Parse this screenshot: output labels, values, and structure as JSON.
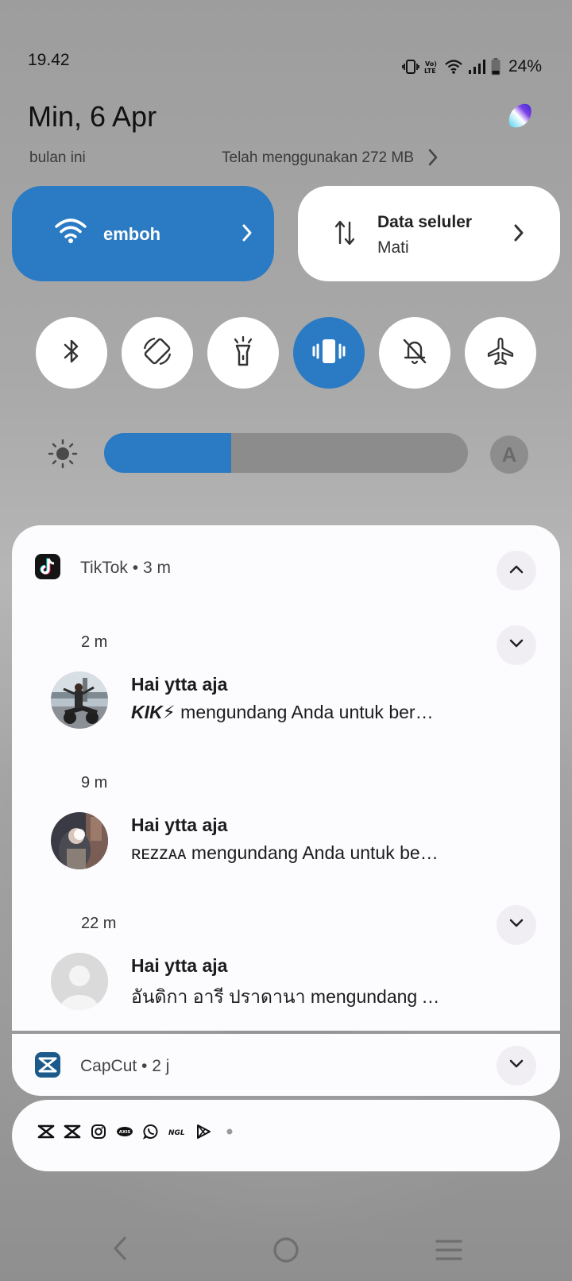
{
  "status_bar": {
    "time": "19.42",
    "battery": "24%",
    "icons": [
      "vibrate-icon",
      "volte-icon",
      "wifi-icon",
      "signal-icon",
      "battery-icon"
    ]
  },
  "header": {
    "date": "Min, 6 Apr",
    "usage_period": "bulan ini",
    "usage_text": "Telah menggunakan 272 MB"
  },
  "tiles": {
    "wifi": {
      "label": "emboh",
      "icon": "wifi-icon"
    },
    "data": {
      "title": "Data seluler",
      "status": "Mati",
      "icon": "data-arrows-icon"
    }
  },
  "toggles": [
    {
      "name": "bluetooth",
      "icon": "bluetooth-icon",
      "active": false
    },
    {
      "name": "auto-rotate",
      "icon": "rotate-icon",
      "active": false
    },
    {
      "name": "flashlight",
      "icon": "flashlight-icon",
      "active": false
    },
    {
      "name": "vibrate",
      "icon": "vibrate-icon",
      "active": true
    },
    {
      "name": "do-not-disturb",
      "icon": "bell-off-icon",
      "active": false
    },
    {
      "name": "airplane-mode",
      "icon": "airplane-icon",
      "active": false
    }
  ],
  "brightness": {
    "level": 0.35,
    "auto_label": "A"
  },
  "notifications": {
    "tiktok": {
      "app": "TikTok",
      "age": "3 m",
      "items": [
        {
          "time": "2 m",
          "title": "Hai ytta aja",
          "sender": "KIK⚡",
          "text": " mengundang Anda untuk bergabung"
        },
        {
          "time": "9 m",
          "title": "Hai ytta aja",
          "sender": "ʀᴇᴢᴢᴀᴀ",
          "text": " mengundang Anda untuk bergabung"
        },
        {
          "time": "22 m",
          "title": "Hai ytta aja",
          "sender": "",
          "text": "อันดิกา อารี ปราดานา mengundang Anda untuk bergabung"
        }
      ]
    },
    "capcut": {
      "app": "CapCut",
      "age": "2 j"
    },
    "more_icons": [
      "capcut-icon",
      "capcut-icon",
      "instagram-icon",
      "axis-icon",
      "whatsapp-icon",
      "ngl-icon",
      "play-store-icon",
      "more-dot-icon"
    ]
  },
  "colors": {
    "accent": "#2a7bc4",
    "card": "#fcfbfe",
    "tiktok": "#000000",
    "capcut": "#1b5a8a"
  }
}
